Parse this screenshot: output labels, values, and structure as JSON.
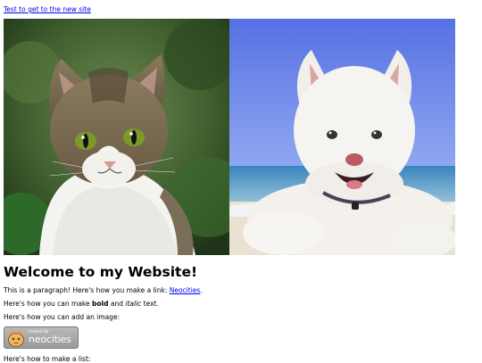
{
  "top_link": "Test to get to the new site",
  "hero": {
    "left_alt": "cat photo",
    "right_alt": "dog photo"
  },
  "heading": "Welcome to my Website!",
  "paragraphs": {
    "p1_text": "This is a paragraph! Here's how you make a link: ",
    "p1_link": "Neocities",
    "p1_end": ".",
    "p2_a": "Here's how you can make ",
    "p2_bold": "bold",
    "p2_b": " and ",
    "p2_italic": "italic",
    "p2_c": " text.",
    "p3": "Here's how you can add an image:",
    "p4": "Here's how to make a list:"
  },
  "badge": {
    "small": "hosted by",
    "big": "neocities"
  },
  "colors": {
    "link": "#0000ee",
    "sky": "#6b86e6",
    "sea": "#3f8fc0"
  }
}
